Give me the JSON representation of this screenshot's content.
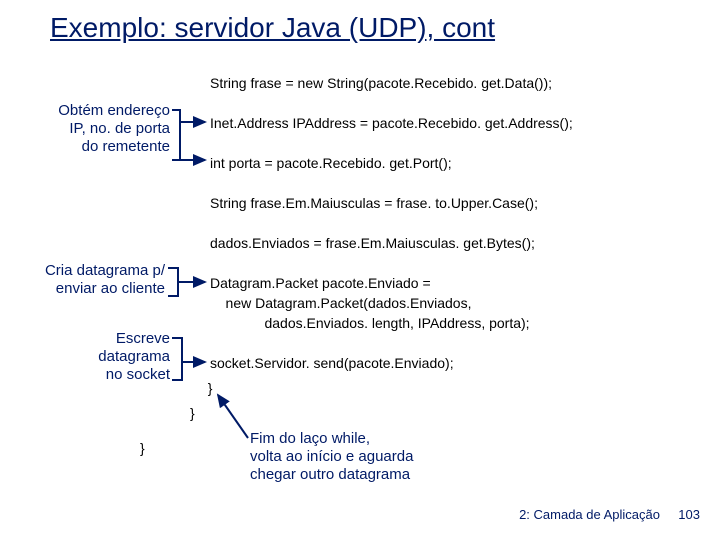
{
  "title": "Exemplo: servidor Java (UDP), cont",
  "code": {
    "l1": "String frase = new String(pacote.Recebido. get.Data());",
    "l2": "Inet.Address IPAddress = pacote.Recebido. get.Address();",
    "l3": "int porta = pacote.Recebido. get.Port();",
    "l4": "String frase.Em.Maiusculas = frase. to.Upper.Case();",
    "l5": "dados.Enviados = frase.Em.Maiusculas. get.Bytes();",
    "l6": "Datagram.Packet pacote.Enviado =",
    "l7": "    new Datagram.Packet(dados.Enviados,",
    "l8": "              dados.Enviados. length, IPAddress, porta);",
    "l9": "socket.Servidor. send(pacote.Enviado);",
    "l10": "  }",
    "l11": "}",
    "l12": "}"
  },
  "ann": {
    "a1_l1": "Obtém endereço",
    "a1_l2": "IP, no. de porta",
    "a1_l3": "do remetente",
    "a2_l1": "Cria datagrama p/",
    "a2_l2": "enviar ao cliente",
    "a3_l1": "Escreve",
    "a3_l2": "datagrama",
    "a3_l3": "no socket",
    "a4_l1": "Fim do laço while,",
    "a4_l2": "volta ao início e aguarda",
    "a4_l3": "chegar outro datagrama"
  },
  "footer": {
    "chapter": "2: Camada de Aplicação",
    "page": "103"
  }
}
